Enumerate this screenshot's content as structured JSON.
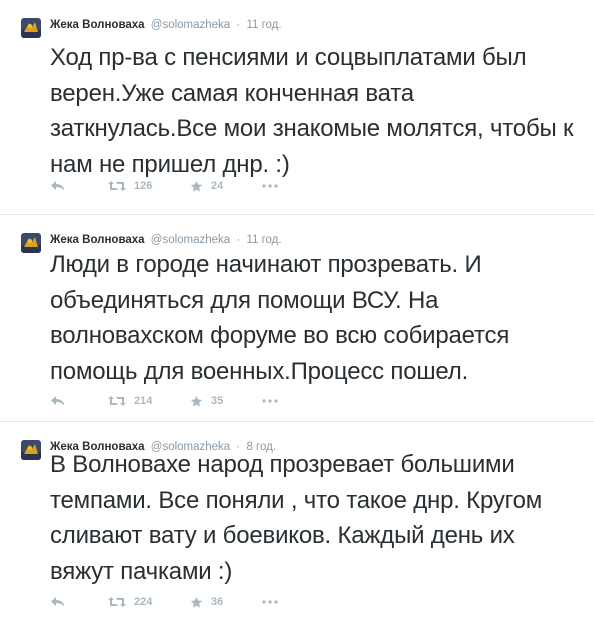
{
  "tweets": [
    {
      "author_name": "Жека Волноваха",
      "username": "@solomazheka",
      "separator": "·",
      "time": "11 год.",
      "text": "Ход пр-ва с пенсиями и соцвыплатами был верен.Уже самая конченная вата заткнулась.Все мои знакомые молятся, чтобы к нам не пришел днр. :)",
      "retweets": "126",
      "favorites": "24"
    },
    {
      "author_name": "Жека Волноваха",
      "username": "@solomazheka",
      "separator": "·",
      "time": "11 год.",
      "text": "Люди в городе начинают прозревать. И объединяться для помощи ВСУ. На волновахском форуме во всю собирается помощь для военных.Процесс пошел.",
      "retweets": "214",
      "favorites": "35"
    },
    {
      "author_name": "Жека Волноваха",
      "username": "@solomazheka",
      "separator": "·",
      "time": "8 год.",
      "text": "В Волновахе народ прозревает большими темпами. Все поняли , что такое днр. Кругом сливают вату и боевиков. Каждый день их вяжут пачками :)",
      "retweets": "224",
      "favorites": "36"
    }
  ],
  "icons": {
    "reply": "reply-icon",
    "retweet": "retweet-icon",
    "favorite": "star-icon",
    "more": "more-dots-icon"
  },
  "colors": {
    "text": "#292f33",
    "meta": "#8899a6",
    "action": "#aab8c2",
    "divider": "#e1e8ed"
  }
}
